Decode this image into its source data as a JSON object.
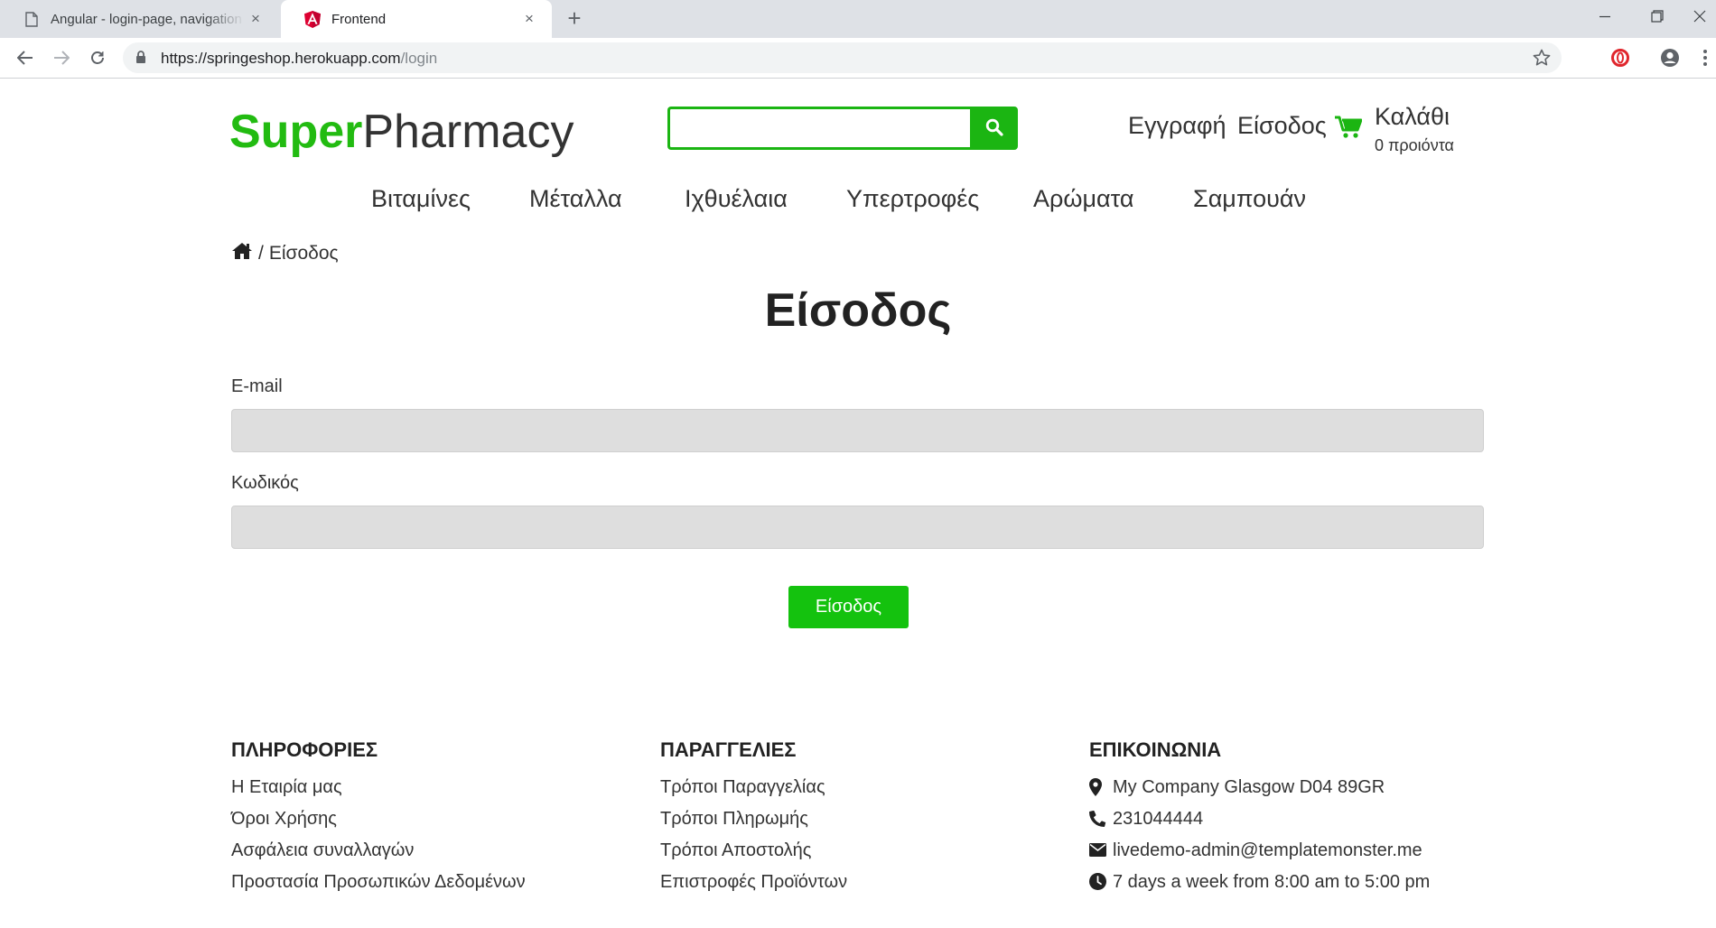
{
  "browser": {
    "tabs": [
      {
        "title": "Angular - login-page, navigation",
        "active": false
      },
      {
        "title": "Frontend",
        "active": true
      }
    ],
    "close_glyph": "×",
    "new_tab_glyph": "+",
    "url": {
      "domain": "https://springeshop.herokuapp.com",
      "path": "/login"
    }
  },
  "header": {
    "logo": {
      "part1": "Super",
      "part2": "Pharmacy"
    },
    "search": {
      "placeholder": "",
      "value": ""
    },
    "links": {
      "register": "Εγγραφή",
      "login": "Είσοδος"
    },
    "cart": {
      "label": "Καλάθι",
      "count_text": "0 προιόντα"
    }
  },
  "categories": [
    "Βιταμίνες",
    "Μέταλλα",
    "Ιχθυέλαια",
    "Υπερτροφές",
    "Αρώματα",
    "Σαμπουάν"
  ],
  "breadcrumb": {
    "separator": "/",
    "current": "Είσοδος"
  },
  "login": {
    "title": "Είσοδος",
    "email_label": "E-mail",
    "email_value": "",
    "password_label": "Κωδικός",
    "password_value": "",
    "submit_label": "Είσοδος"
  },
  "footer": {
    "info": {
      "heading": "ΠΛΗΡΟΦΟΡΙΕΣ",
      "items": [
        "Η Εταιρία μας",
        "Όροι Χρήσης",
        "Ασφάλεια συναλλαγών",
        "Προστασία Προσωπικών Δεδομένων"
      ]
    },
    "orders": {
      "heading": "ΠΑΡΑΓΓΕΛΙΕΣ",
      "items": [
        "Τρόποι Παραγγελίας",
        "Τρόποι Πληρωμής",
        "Τρόποι Αποστολής",
        "Επιστροφές Προϊόντων"
      ]
    },
    "contact": {
      "heading": "ΕΠΙΚΟΙΝΩΝΙΑ",
      "items": [
        {
          "icon": "map-marker-icon",
          "text": "My Company Glasgow D04 89GR"
        },
        {
          "icon": "phone-icon",
          "text": "231044444"
        },
        {
          "icon": "envelope-icon",
          "text": "livedemo-admin@templatemonster.me"
        },
        {
          "icon": "clock-icon",
          "text": "7 days a week from 8:00 am to 5:00 pm"
        }
      ]
    }
  },
  "colors": {
    "brand_green": "#22bb11",
    "button_green": "#14c20e",
    "input_gray": "#dedede"
  }
}
